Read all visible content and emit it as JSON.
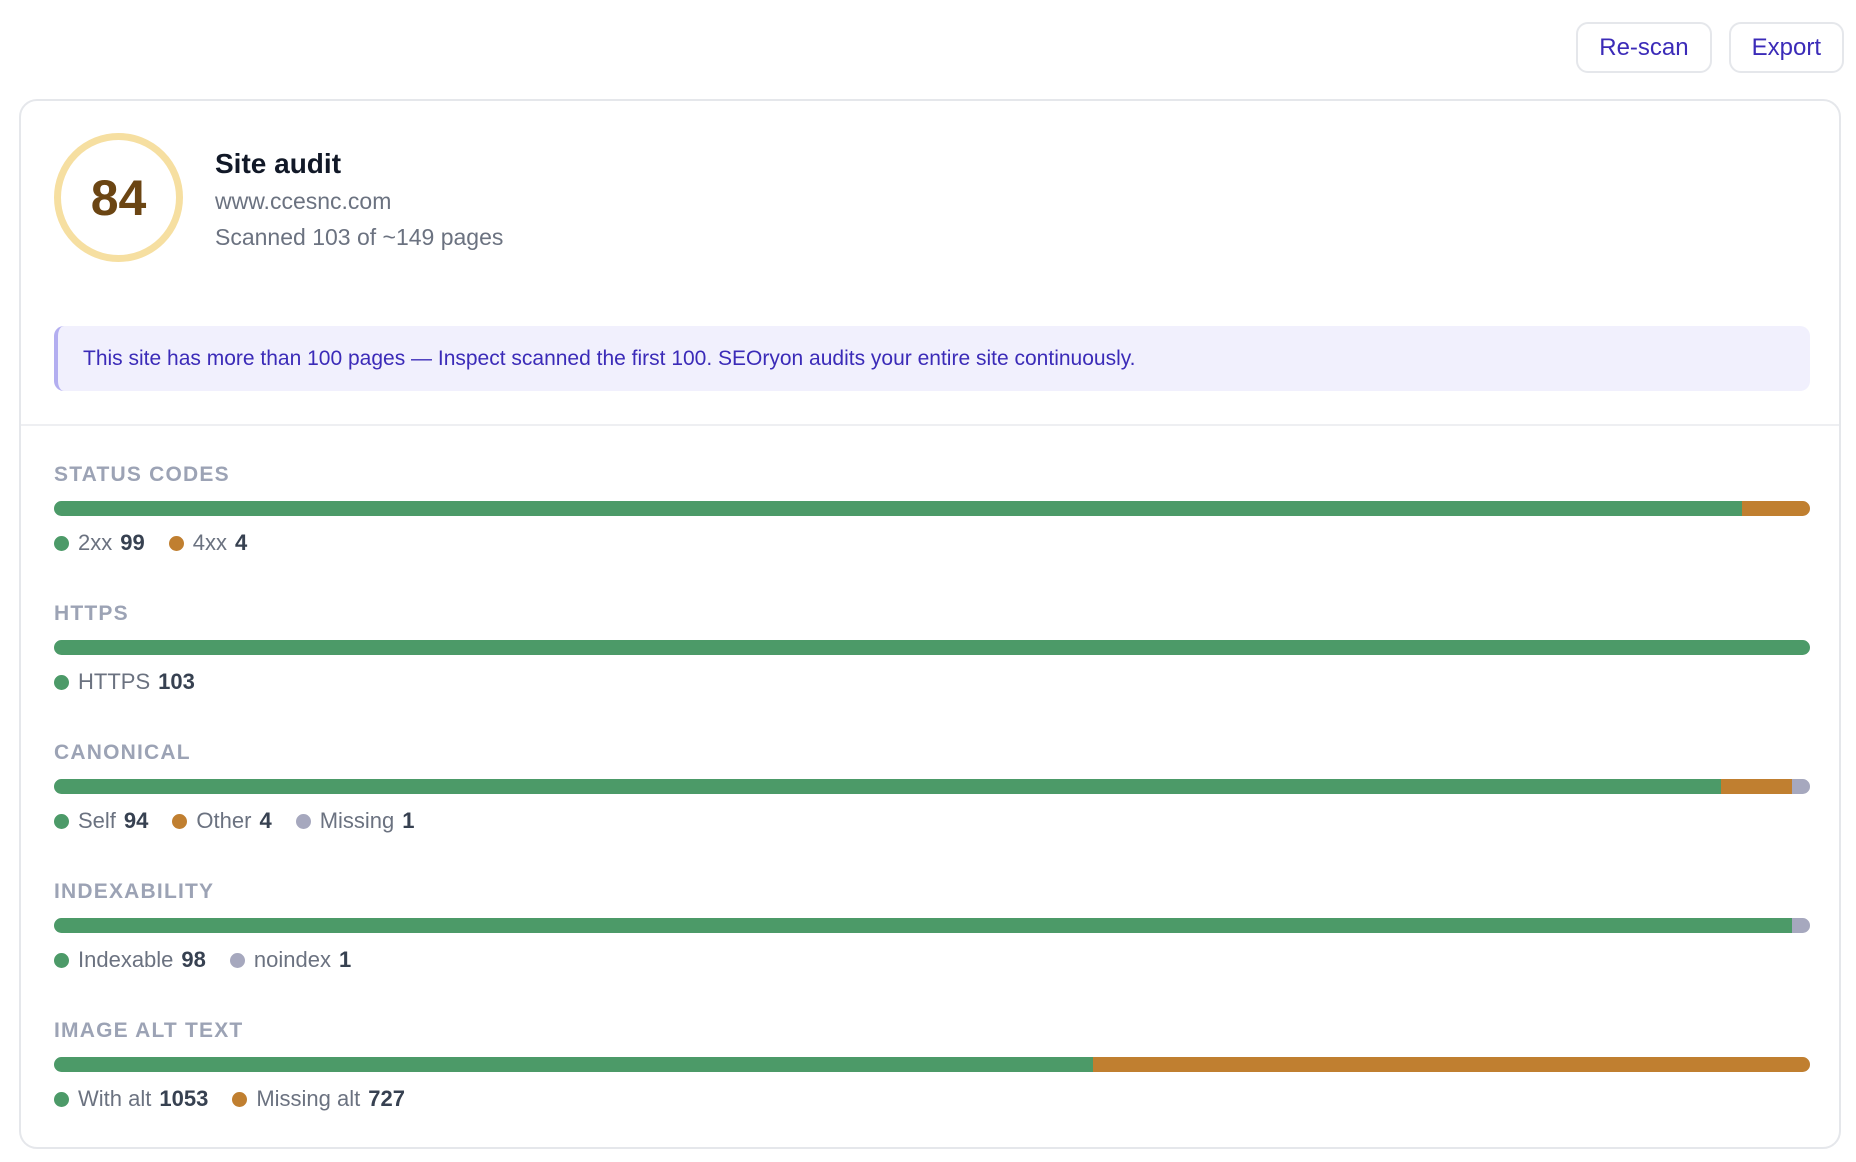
{
  "colors": {
    "good": "#4c9a68",
    "warn": "#c07f30",
    "neutral": "#a6a8be",
    "accent": "#3b2bb8",
    "score_ring": "#f6dfa1",
    "score_text": "#6b4513"
  },
  "toolbar": {
    "rescan_label": "Re-scan",
    "export_label": "Export"
  },
  "audit": {
    "score": "84",
    "title": "Site audit",
    "domain": "www.ccesnc.com",
    "scanned": "Scanned 103 of ~149 pages"
  },
  "notice": {
    "text": "This site has more than 100 pages — Inspect scanned the first 100. SEOryon audits your entire site continuously."
  },
  "sections": [
    {
      "id": "status-codes",
      "title": "STATUS CODES",
      "items": [
        {
          "label": "2xx",
          "count": 99,
          "color": "#4c9a68"
        },
        {
          "label": "4xx",
          "count": 4,
          "color": "#c07f30"
        }
      ]
    },
    {
      "id": "https",
      "title": "HTTPS",
      "items": [
        {
          "label": "HTTPS",
          "count": 103,
          "color": "#4c9a68"
        }
      ]
    },
    {
      "id": "canonical",
      "title": "CANONICAL",
      "items": [
        {
          "label": "Self",
          "count": 94,
          "color": "#4c9a68"
        },
        {
          "label": "Other",
          "count": 4,
          "color": "#c07f30"
        },
        {
          "label": "Missing",
          "count": 1,
          "color": "#a6a8be"
        }
      ]
    },
    {
      "id": "indexability",
      "title": "INDEXABILITY",
      "items": [
        {
          "label": "Indexable",
          "count": 98,
          "color": "#4c9a68"
        },
        {
          "label": "noindex",
          "count": 1,
          "color": "#a6a8be"
        }
      ]
    },
    {
      "id": "image-alt-text",
      "title": "IMAGE ALT TEXT",
      "items": [
        {
          "label": "With alt",
          "count": 1053,
          "color": "#4c9a68"
        },
        {
          "label": "Missing alt",
          "count": 727,
          "color": "#c07f30"
        }
      ]
    }
  ]
}
